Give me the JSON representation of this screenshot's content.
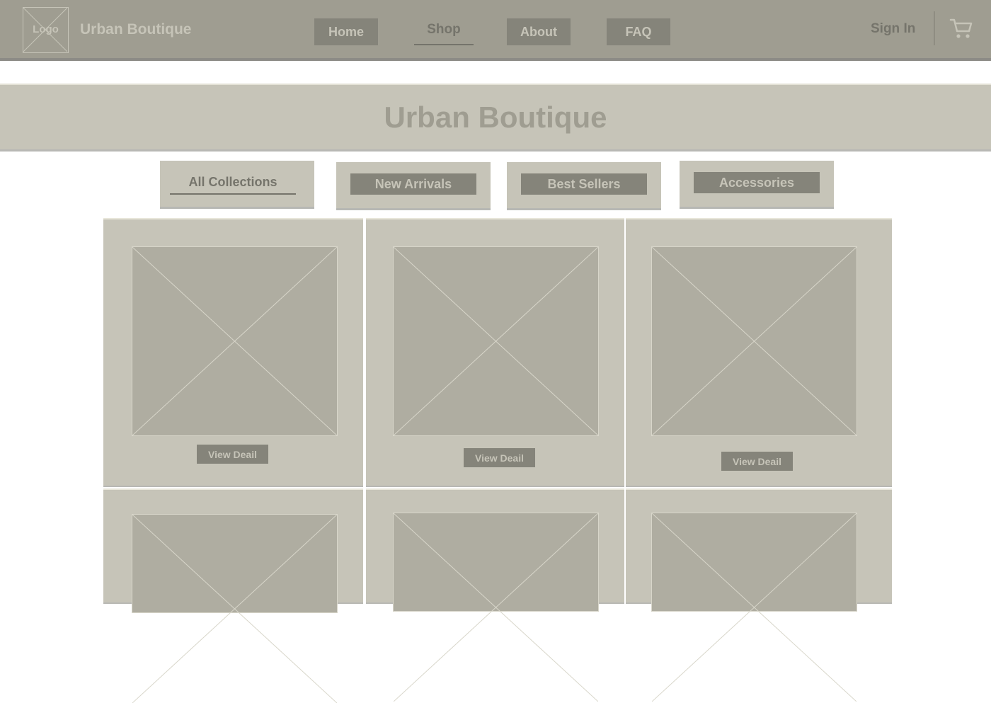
{
  "header": {
    "logo_text": "Logo",
    "brand": "Urban Boutique",
    "nav": {
      "home": "Home",
      "shop": "Shop",
      "about": "About",
      "faq": "FAQ"
    },
    "sign_in": "Sign In",
    "cart_icon": "shopping-cart-icon"
  },
  "hero": {
    "title": "Urban Boutique"
  },
  "categories": {
    "all": "All Collections",
    "new": "New Arrivals",
    "best": "Best Sellers",
    "accessories": "Accessories"
  },
  "products": {
    "cta_1": "View Deail",
    "cta_2": "View Deail",
    "cta_3": "View Deail"
  },
  "colors": {
    "header_bg": "#9f9d91",
    "panel_bg": "#c6c4b8",
    "button_bg": "#85847a",
    "placeholder_bg": "#afada1",
    "text_dark": "#75746b"
  }
}
